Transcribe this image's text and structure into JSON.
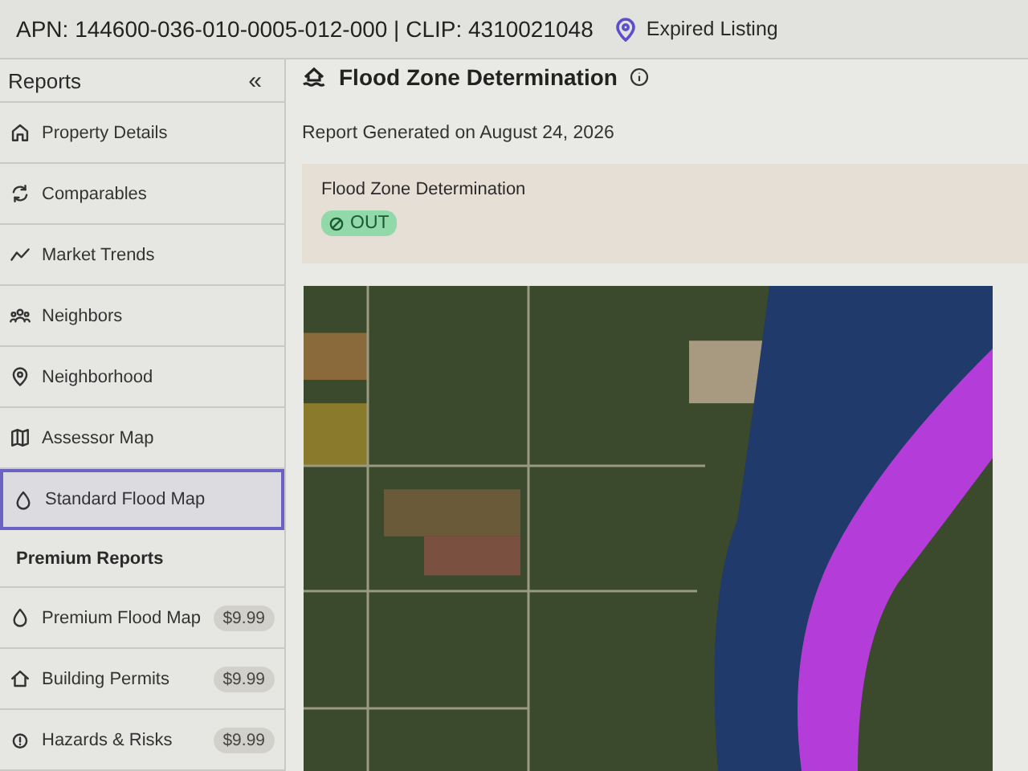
{
  "header": {
    "parcel": "APN: 144600-036-010-0005-012-000 | CLIP: 4310021048",
    "status": "Expired Listing"
  },
  "sidebar": {
    "title": "Reports",
    "collapse": "«",
    "items": [
      {
        "label": "Property Details",
        "selected": false
      },
      {
        "label": "Comparables",
        "selected": false
      },
      {
        "label": "Market Trends",
        "selected": false
      },
      {
        "label": "Neighbors",
        "selected": false
      },
      {
        "label": "Neighborhood",
        "selected": false
      },
      {
        "label": "Assessor Map",
        "selected": false
      },
      {
        "label": "Standard Flood Map",
        "selected": true
      }
    ],
    "premium_heading": "Premium Reports",
    "premium_items": [
      {
        "label": "Premium Flood Map",
        "price": "$9.99",
        "selected": false
      },
      {
        "label": "Building Permits",
        "price": "$9.99",
        "selected": false
      },
      {
        "label": "Hazards & Risks",
        "price": "$9.99",
        "selected": false
      }
    ]
  },
  "main": {
    "title": "Flood Zone Determination",
    "generated": "Report Generated on August 24, 2026",
    "result_card": {
      "label": "Flood Zone Determination",
      "badge": "OUT"
    }
  }
}
